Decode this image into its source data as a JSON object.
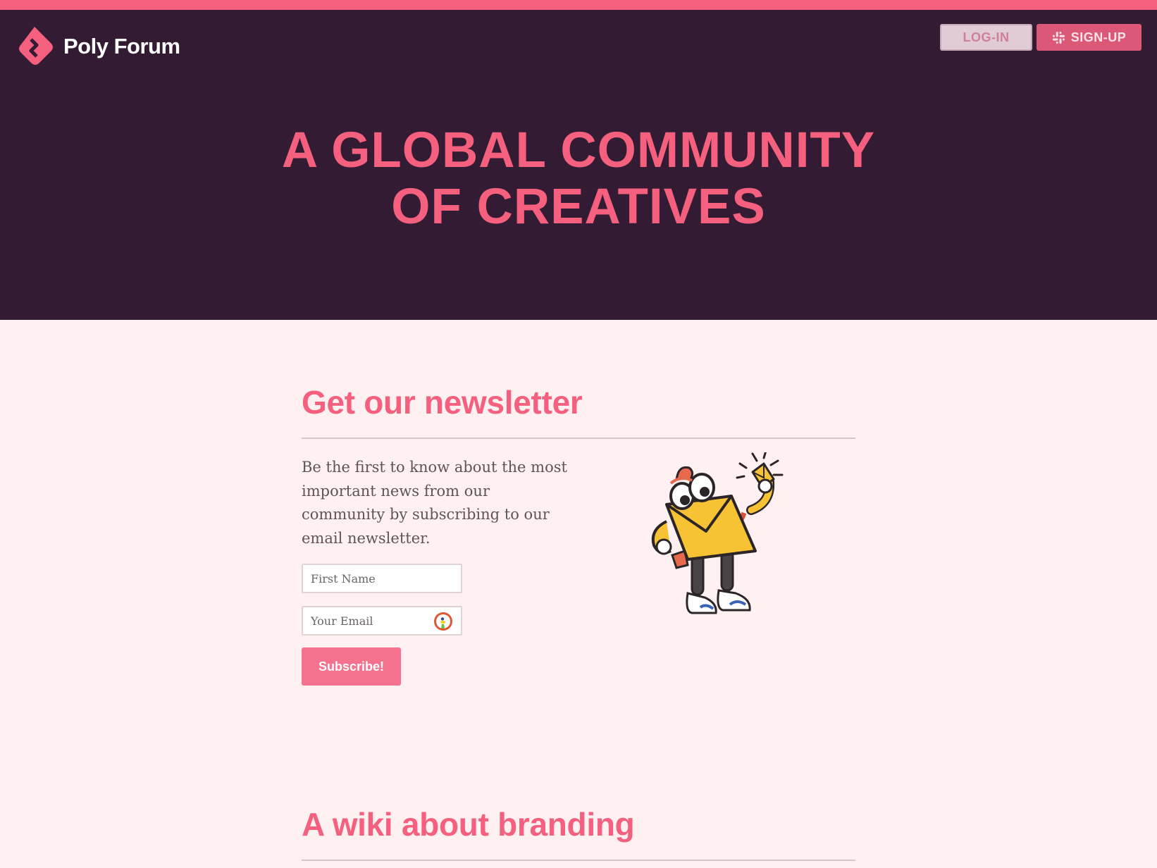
{
  "brand": {
    "name": "Poly Forum",
    "accent": "#f4607e",
    "hero_bg": "#331c33",
    "page_bg": "#fff1f1"
  },
  "header": {
    "login_label": "LOG-IN",
    "signup_label": "SIGN-UP",
    "signup_icon": "slack-icon"
  },
  "hero": {
    "title_line1": "A GLOBAL COMMUNITY",
    "title_line2": "OF CREATIVES"
  },
  "newsletter": {
    "title": "Get our newsletter",
    "description": "Be the first to know about the most important news from our community by subscribing to our email newsletter.",
    "first_name_placeholder": "First Name",
    "email_placeholder": "Your Email",
    "email_icon": "duckduckgo-icon",
    "subscribe_label": "Subscribe!",
    "illustration": "envelope-mascot-illustration"
  },
  "wiki": {
    "title": "A wiki about branding"
  }
}
